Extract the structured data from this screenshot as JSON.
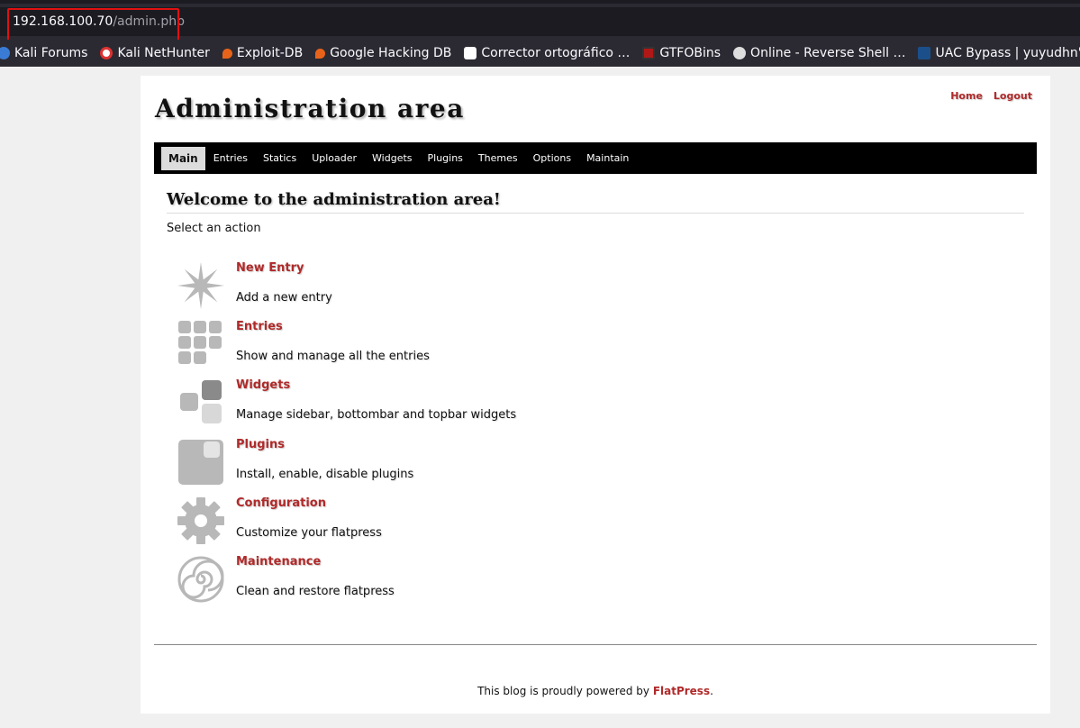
{
  "browser": {
    "url_host": "192.168.100.70",
    "url_path": "/admin.php",
    "bookmarks": [
      {
        "label": "Kali Forums",
        "icon": "kali-dragon-icon",
        "color": "#3a7bd5"
      },
      {
        "label": "Kali NetHunter",
        "icon": "nethunter-icon",
        "color": "#d33"
      },
      {
        "label": "Exploit-DB",
        "icon": "exploitdb-icon",
        "color": "#e8631a"
      },
      {
        "label": "Google Hacking DB",
        "icon": "ghdb-icon",
        "color": "#e8631a"
      },
      {
        "label": "Corrector ortográfico …",
        "icon": "languagetool-icon",
        "color": "#ffffff"
      },
      {
        "label": "GTFOBins",
        "icon": "gtfobins-icon",
        "color": "#b01818"
      },
      {
        "label": "Online - Reverse Shell …",
        "icon": "skull-icon",
        "color": "#dddddd"
      },
      {
        "label": "UAC Bypass | yuyudhn'…",
        "icon": "uac-icon",
        "color": "#1b4f8a"
      }
    ]
  },
  "site": {
    "title": "Administration area",
    "links": {
      "home": "Home",
      "logout": "Logout"
    }
  },
  "nav": {
    "tabs": [
      "Main",
      "Entries",
      "Statics",
      "Uploader",
      "Widgets",
      "Plugins",
      "Themes",
      "Options",
      "Maintain"
    ],
    "active": "Main"
  },
  "main": {
    "heading": "Welcome to the administration area!",
    "subtitle": "Select an action",
    "actions": [
      {
        "title": "New Entry",
        "desc": "Add a new entry",
        "icon": "star-burst-icon"
      },
      {
        "title": "Entries",
        "desc": "Show and manage all the entries",
        "icon": "grid-icon"
      },
      {
        "title": "Widgets",
        "desc": "Manage sidebar, bottombar and topbar widgets",
        "icon": "widgets-icon"
      },
      {
        "title": "Plugins",
        "desc": "Install, enable, disable plugins",
        "icon": "plugin-icon"
      },
      {
        "title": "Configuration",
        "desc": "Customize your flatpress",
        "icon": "gear-icon"
      },
      {
        "title": "Maintenance",
        "desc": "Clean and restore flatpress",
        "icon": "spiral-icon"
      }
    ]
  },
  "footer": {
    "text": "This blog is proudly powered by ",
    "link": "FlatPress",
    "suffix": "."
  },
  "colors": {
    "link": "#b02a2a",
    "icon_gray": "#b8b8b8",
    "icon_dark": "#8a8a8a",
    "url_highlight": "#e01010"
  }
}
